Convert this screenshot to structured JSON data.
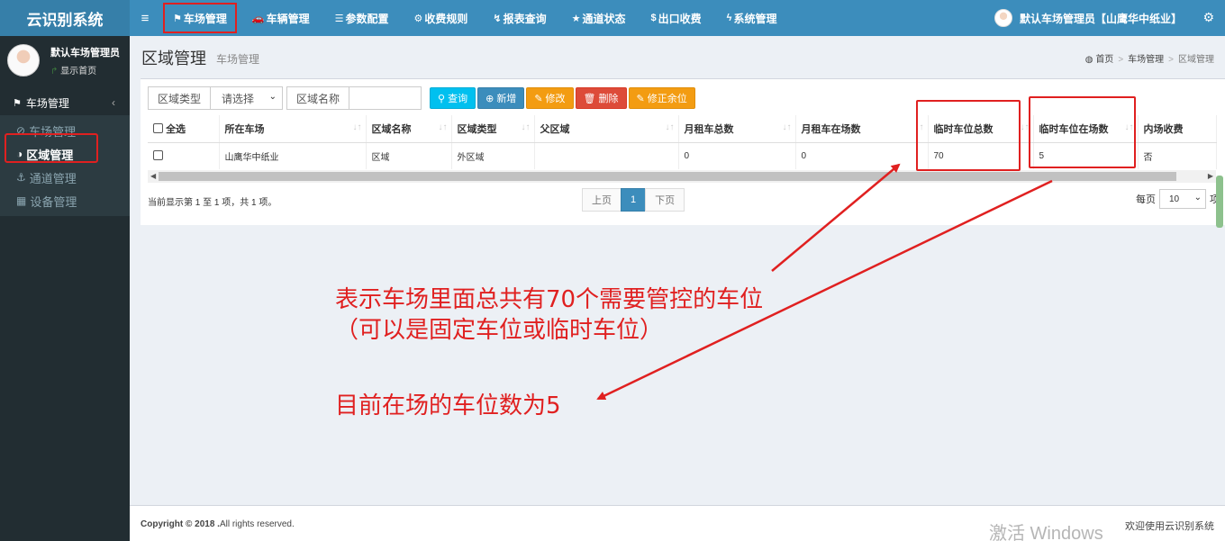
{
  "app": {
    "title": "云识别系统"
  },
  "topnav": {
    "toggle": "≡",
    "items": [
      {
        "label": "车场管理",
        "icon": "flag-icon"
      },
      {
        "label": "车辆管理",
        "icon": "car-icon"
      },
      {
        "label": "参数配置",
        "icon": "sliders-icon"
      },
      {
        "label": "收费规则",
        "icon": "cogs-icon"
      },
      {
        "label": "报表查询",
        "icon": "chart-icon"
      },
      {
        "label": "通道状态",
        "icon": "star-icon"
      },
      {
        "label": "出口收费",
        "icon": "money-icon"
      },
      {
        "label": "系统管理",
        "icon": "wrench-icon"
      }
    ],
    "user": "默认车场管理员【山鹰华中纸业】"
  },
  "sidebar": {
    "user_name": "默认车场管理员",
    "home_label": "显示首页",
    "menu_head": "车场管理",
    "items": [
      {
        "label": "车场管理",
        "icon": "ban-icon"
      },
      {
        "label": "区域管理",
        "icon": "adjust-icon"
      },
      {
        "label": "通道管理",
        "icon": "anchor-icon"
      },
      {
        "label": "设备管理",
        "icon": "device-icon"
      }
    ]
  },
  "page": {
    "title": "区域管理",
    "subtitle": "车场管理",
    "breadcrumb": [
      "首页",
      "车场管理",
      "区域管理"
    ]
  },
  "toolbar": {
    "area_type_label": "区域类型",
    "area_type_value": "请选择",
    "area_name_label": "区域名称",
    "area_name_value": "",
    "buttons": [
      "查询",
      "新增",
      "修改",
      "删除",
      "修正余位"
    ]
  },
  "table": {
    "select_all": "全选",
    "columns": [
      "所在车场",
      "区域名称",
      "区域类型",
      "父区域",
      "月租车总数",
      "月租车在场数",
      "临时车位总数",
      "临时车位在场数",
      "内场收费"
    ],
    "rows": [
      [
        "山鹰华中纸业",
        "区域",
        "外区域",
        "",
        "0",
        "0",
        "70",
        "5",
        "否"
      ]
    ]
  },
  "pagination": {
    "info": "当前显示第 1 至 1 项，共 1 项。",
    "prev": "上页",
    "current": "1",
    "next": "下页",
    "per_page_prefix": "每页",
    "per_page_value": "10",
    "per_page_suffix": "项"
  },
  "footer": {
    "copyright_bold": "Copyright © 2018 .",
    "copyright_rest": "All rights reserved.",
    "welcome": "欢迎使用云识别系统"
  },
  "watermark": "激活 Windows",
  "annotations": {
    "line1": "表示车场里面总共有70个需要管控的车位",
    "line2": "（可以是固定车位或临时车位）",
    "line3": "目前在场的车位数为5",
    "color": "#e02020"
  }
}
